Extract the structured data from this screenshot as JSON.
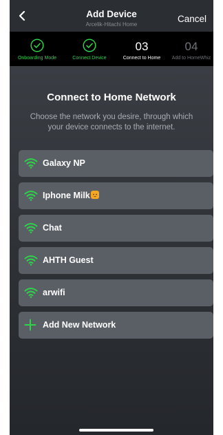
{
  "header": {
    "title": "Add Device",
    "subtitle": "Arcelik-Hitachi Home",
    "cancel_label": "Cancel",
    "back_icon": "chevron-left-icon"
  },
  "steps": [
    {
      "label": "Onboarding Mode",
      "status": "done",
      "icon": "check-circle-icon"
    },
    {
      "label": "Connect Device",
      "status": "done",
      "icon": "check-circle-icon"
    },
    {
      "label": "Connect to Home",
      "status": "current",
      "number": "03"
    },
    {
      "label": "Add to HomeWhiz",
      "status": "upcoming",
      "number": "04"
    }
  ],
  "main": {
    "heading": "Connect to Home Network",
    "description": "Choose the network you desire, through which your device connects to the internet."
  },
  "networks": [
    {
      "name": "Galaxy NP",
      "icon": "wifi-icon",
      "signal_color": "#2fd24a"
    },
    {
      "name": "Iphone Milk",
      "icon": "wifi-icon",
      "signal_color": "#2fd24a",
      "emoji": "cat-face-emoji"
    },
    {
      "name": "Chat",
      "icon": "wifi-icon",
      "signal_color": "#2fd24a"
    },
    {
      "name": "AHTH Guest",
      "icon": "wifi-icon",
      "signal_color": "#2fd24a"
    },
    {
      "name": "arwifi",
      "icon": "wifi-icon",
      "signal_color": "#2fd24a"
    }
  ],
  "add_network": {
    "label": "Add New Network",
    "icon": "plus-icon"
  },
  "colors": {
    "accent_green": "#2fd24a",
    "background": "#34373c",
    "card": "#5a5e65",
    "step_bar": "#000000"
  }
}
